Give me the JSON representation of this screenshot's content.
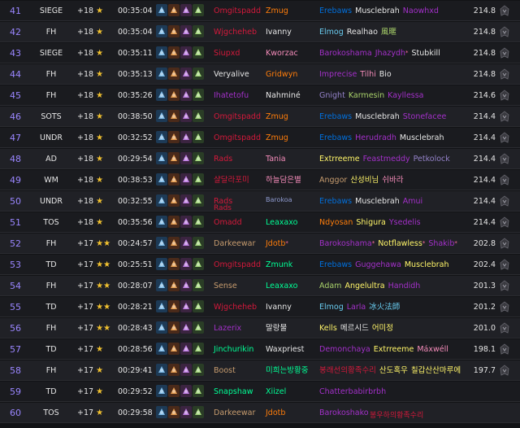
{
  "colors": {
    "rank": "#9a86ff",
    "star": "#f2c230",
    "white": "#e6e6e6",
    "deathknight": "#d4193b",
    "demonhunter": "#a330c9",
    "druid": "#ff7d0a",
    "hunter": "#a9d26a",
    "mage": "#69ccf0",
    "monk": "#00ff96",
    "paladin": "#f58cba",
    "priest": "#ffffff",
    "rogue": "#fff569",
    "shaman": "#0070de",
    "warlock": "#9482c9",
    "warrior": "#c79c6e"
  },
  "leaderboard": {
    "rows": [
      {
        "rank": "41",
        "dungeon": "SIEGE",
        "level": "+18",
        "stars": 1,
        "time": "00:35:04",
        "score": "214.8",
        "tank": {
          "name": "Omgitspadd",
          "class": "deathknight"
        },
        "healer": {
          "name": "Zmug",
          "class": "druid"
        },
        "dps": [
          {
            "name": "Erebaws",
            "class": "shaman"
          },
          {
            "name": "Musclebrah",
            "class": "white"
          },
          {
            "name": "Naowhxd",
            "class": "demonhunter"
          }
        ]
      },
      {
        "rank": "42",
        "dungeon": "FH",
        "level": "+18",
        "stars": 1,
        "time": "00:35:04",
        "score": "214.8",
        "tank": {
          "name": "Wjgcheheb",
          "class": "deathknight"
        },
        "healer": {
          "name": "Ivanny",
          "class": "white"
        },
        "dps": [
          {
            "name": "Elmog",
            "class": "mage"
          },
          {
            "name": "Realhao",
            "class": "white"
          },
          {
            "name": "風暱",
            "class": "hunter"
          }
        ]
      },
      {
        "rank": "43",
        "dungeon": "SIEGE",
        "level": "+18",
        "stars": 1,
        "time": "00:35:11",
        "score": "214.8",
        "tank": {
          "name": "Siupxd",
          "class": "deathknight"
        },
        "healer": {
          "name": "Kworzac",
          "class": "paladin"
        },
        "dps": [
          {
            "name": "Barokoshama",
            "class": "demonhunter"
          },
          {
            "name": "Jhazydh",
            "class": "demonhunter",
            "mark": "*"
          },
          {
            "name": "Stubkill",
            "class": "white"
          }
        ]
      },
      {
        "rank": "44",
        "dungeon": "FH",
        "level": "+18",
        "stars": 1,
        "time": "00:35:13",
        "score": "214.8",
        "tank": {
          "name": "Veryalive",
          "class": "white"
        },
        "healer": {
          "name": "Gridwyn",
          "class": "druid"
        },
        "dps": [
          {
            "name": "Imprecise",
            "class": "demonhunter"
          },
          {
            "name": "Tilhi",
            "class": "paladin"
          },
          {
            "name": "Bio",
            "class": "white"
          }
        ]
      },
      {
        "rank": "45",
        "dungeon": "FH",
        "level": "+18",
        "stars": 1,
        "time": "00:35:26",
        "score": "214.6",
        "tank": {
          "name": "Ihatetofu",
          "class": "demonhunter"
        },
        "healer": {
          "name": "Nahminé",
          "class": "white"
        },
        "dps": [
          {
            "name": "Gnight",
            "class": "warlock"
          },
          {
            "name": "Karmesin",
            "class": "hunter"
          },
          {
            "name": "Kayllessa",
            "class": "demonhunter"
          }
        ]
      },
      {
        "rank": "46",
        "dungeon": "SOTS",
        "level": "+18",
        "stars": 1,
        "time": "00:38:50",
        "score": "214.4",
        "tank": {
          "name": "Omgitspadd",
          "class": "deathknight"
        },
        "healer": {
          "name": "Zmug",
          "class": "druid"
        },
        "dps": [
          {
            "name": "Erebaws",
            "class": "shaman"
          },
          {
            "name": "Musclebrah",
            "class": "white"
          },
          {
            "name": "Stonefacee",
            "class": "demonhunter"
          }
        ]
      },
      {
        "rank": "47",
        "dungeon": "UNDR",
        "level": "+18",
        "stars": 1,
        "time": "00:32:52",
        "score": "214.4",
        "tank": {
          "name": "Omgitspadd",
          "class": "deathknight"
        },
        "healer": {
          "name": "Zmug",
          "class": "druid"
        },
        "dps": [
          {
            "name": "Erebaws",
            "class": "shaman"
          },
          {
            "name": "Herudradh",
            "class": "demonhunter"
          },
          {
            "name": "Musclebrah",
            "class": "white"
          }
        ]
      },
      {
        "rank": "48",
        "dungeon": "AD",
        "level": "+18",
        "stars": 1,
        "time": "00:29:54",
        "score": "214.4",
        "tank": {
          "name": "Rads",
          "class": "deathknight"
        },
        "healer": {
          "name": "Tania",
          "class": "paladin"
        },
        "dps": [
          {
            "name": "Extrreeme",
            "class": "rogue"
          },
          {
            "name": "Feastmeddy",
            "class": "demonhunter"
          },
          {
            "name": "Petkolock",
            "class": "warlock"
          }
        ]
      },
      {
        "rank": "49",
        "dungeon": "WM",
        "level": "+18",
        "stars": 1,
        "time": "00:38:53",
        "score": "214.4",
        "tank": {
          "name": "샬달라포미",
          "class": "deathknight"
        },
        "healer": {
          "name": "하늘담은별",
          "class": "paladin"
        },
        "dps": [
          {
            "name": "Anggor",
            "class": "warrior"
          },
          {
            "name": "산성비님",
            "class": "rogue"
          },
          {
            "name": "쉬바라",
            "class": "paladin"
          }
        ]
      },
      {
        "rank": "50",
        "dungeon": "UNDR",
        "level": "+18",
        "stars": 1,
        "time": "00:32:55",
        "score": "214.4",
        "tank": {
          "name": "Rads",
          "class": "deathknight"
        },
        "healer": {
          "name": "",
          "class": "white"
        },
        "dps": [
          {
            "name": "Erebaws",
            "class": "shaman"
          },
          {
            "name": "Musclebrah",
            "class": "white"
          },
          {
            "name": "Amui",
            "class": "demonhunter"
          }
        ]
      },
      {
        "rank": "51",
        "dungeon": "TOS",
        "level": "+18",
        "stars": 1,
        "time": "00:35:56",
        "score": "214.4",
        "tank": {
          "name": "Omadd",
          "class": "deathknight"
        },
        "healer": {
          "name": "Leaxaxo",
          "class": "monk"
        },
        "dps": [
          {
            "name": "Ndyosan",
            "class": "druid"
          },
          {
            "name": "Shigura",
            "class": "rogue"
          },
          {
            "name": "Ysedelis",
            "class": "demonhunter"
          }
        ]
      },
      {
        "rank": "52",
        "dungeon": "FH",
        "level": "+17",
        "stars": 2,
        "time": "00:24:57",
        "score": "202.8",
        "tank": {
          "name": "Darkeewar",
          "class": "warrior"
        },
        "healer": {
          "name": "Jdotb",
          "class": "druid",
          "mark": "*"
        },
        "dps": [
          {
            "name": "Barokoshama",
            "class": "demonhunter",
            "mark": "*"
          },
          {
            "name": "Notflawless",
            "class": "rogue",
            "mark": "*"
          },
          {
            "name": "Shakib",
            "class": "demonhunter",
            "mark": "*"
          }
        ]
      },
      {
        "rank": "53",
        "dungeon": "TD",
        "level": "+17",
        "stars": 2,
        "time": "00:25:51",
        "score": "202.4",
        "tank": {
          "name": "Omgitspadd",
          "class": "deathknight"
        },
        "healer": {
          "name": "Zmunk",
          "class": "monk"
        },
        "dps": [
          {
            "name": "Erebaws",
            "class": "shaman"
          },
          {
            "name": "Guggehawa",
            "class": "demonhunter"
          },
          {
            "name": "Musclebrah",
            "class": "rogue"
          }
        ]
      },
      {
        "rank": "54",
        "dungeon": "FH",
        "level": "+17",
        "stars": 2,
        "time": "00:28:07",
        "score": "201.3",
        "tank": {
          "name": "Sense",
          "class": "warrior"
        },
        "healer": {
          "name": "Leaxaxo",
          "class": "monk"
        },
        "dps": [
          {
            "name": "Adam",
            "class": "hunter"
          },
          {
            "name": "Angelultra",
            "class": "rogue"
          },
          {
            "name": "Handidh",
            "class": "demonhunter"
          }
        ]
      },
      {
        "rank": "55",
        "dungeon": "TD",
        "level": "+17",
        "stars": 2,
        "time": "00:28:21",
        "score": "201.2",
        "tank": {
          "name": "Wjgcheheb",
          "class": "deathknight"
        },
        "healer": {
          "name": "Ivanny",
          "class": "white"
        },
        "dps": [
          {
            "name": "Elmog",
            "class": "mage"
          },
          {
            "name": "Larla",
            "class": "demonhunter"
          },
          {
            "name": "冰火法師",
            "class": "mage"
          }
        ]
      },
      {
        "rank": "56",
        "dungeon": "FH",
        "level": "+17",
        "stars": 2,
        "time": "00:28:43",
        "score": "201.0",
        "tank": {
          "name": "Lazerix",
          "class": "demonhunter"
        },
        "healer": {
          "name": "말랑물",
          "class": "white"
        },
        "dps": [
          {
            "name": "Kells",
            "class": "rogue"
          },
          {
            "name": "메르시드",
            "class": "white"
          },
          {
            "name": "어미정",
            "class": "rogue"
          }
        ]
      },
      {
        "rank": "57",
        "dungeon": "TD",
        "level": "+17",
        "stars": 1,
        "time": "00:28:56",
        "score": "198.1",
        "tank": {
          "name": "Jinchurikin",
          "class": "monk"
        },
        "healer": {
          "name": "Waxpriest",
          "class": "white"
        },
        "dps": [
          {
            "name": "Demonchaya",
            "class": "demonhunter"
          },
          {
            "name": "Extrreeme",
            "class": "rogue"
          },
          {
            "name": "Máxwéll",
            "class": "paladin"
          }
        ]
      },
      {
        "rank": "58",
        "dungeon": "FH",
        "level": "+17",
        "stars": 1,
        "time": "00:29:41",
        "score": "197.7",
        "tank": {
          "name": "Boost",
          "class": "warrior"
        },
        "healer": {
          "name": "미희는방황중",
          "class": "monk"
        },
        "dps": [
          {
            "name": "봉래선의황족수리",
            "class": "deathknight"
          },
          {
            "name": "산도혹우",
            "class": "rogue"
          },
          {
            "name": "칠갑산산마루에",
            "class": "rogue"
          }
        ]
      },
      {
        "rank": "59",
        "dungeon": "TD",
        "level": "+17",
        "stars": 1,
        "time": "00:29:52",
        "score": "",
        "tank": {
          "name": "Snapshaw",
          "class": "monk"
        },
        "healer": {
          "name": "Xiizel",
          "class": "monk"
        },
        "dps": [
          {
            "name": "Chatterbabirbrbh",
            "class": "demonhunter"
          }
        ]
      },
      {
        "rank": "60",
        "dungeon": "TOS",
        "level": "+17",
        "stars": 1,
        "time": "00:29:58",
        "score": "",
        "tank": {
          "name": "Darkeewar",
          "class": "warrior"
        },
        "healer": {
          "name": "Jdotb",
          "class": "druid"
        },
        "dps": [
          {
            "name": "Barokoshako",
            "class": "demonhunter"
          }
        ]
      }
    ],
    "overlays": {
      "healer_50": "Barokoa",
      "tank_51_top": "Rads",
      "korean_60": "봉우하의황족수리"
    }
  }
}
